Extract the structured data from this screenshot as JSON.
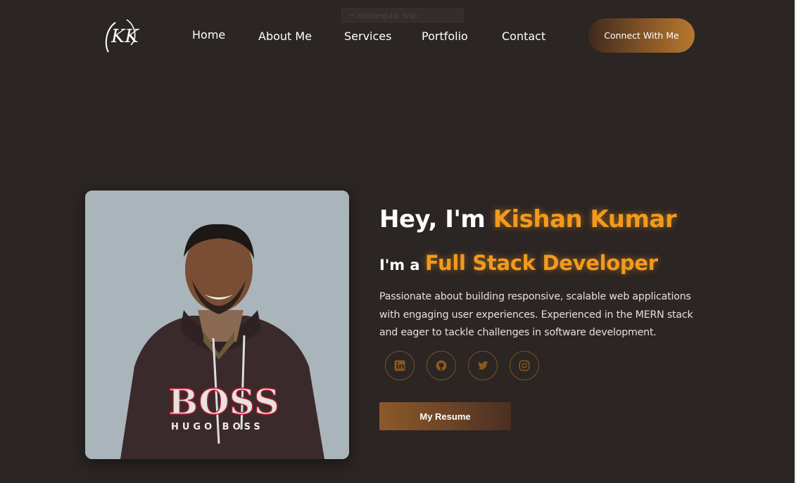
{
  "overlay": {
    "snip_label": "Rectangular Snip"
  },
  "brand": {
    "logo_text": "KK"
  },
  "nav": {
    "items": [
      {
        "label": "Home"
      },
      {
        "label": "About Me"
      },
      {
        "label": "Services"
      },
      {
        "label": "Portfolio"
      },
      {
        "label": "Contact"
      }
    ],
    "cta_label": "Connect With Me"
  },
  "hero": {
    "greeting": "Hey, I'm ",
    "name": "Kishan Kumar",
    "role_prefix": "I'm a ",
    "role": "Full Stack Developer",
    "bio": "Passionate about building responsive, scalable web applications with engaging user experiences. Experienced in the MERN stack and eager to tackle challenges in software development.",
    "photo": {
      "hoodie_brand": "BOSS",
      "hoodie_subtext": "HUGO BOSS"
    },
    "socials": [
      {
        "icon": "linkedin-icon"
      },
      {
        "icon": "github-icon"
      },
      {
        "icon": "twitter-icon"
      },
      {
        "icon": "instagram-icon"
      }
    ],
    "resume_label": "My Resume"
  },
  "colors": {
    "background": "#2b2524",
    "accent": "#f39a1c",
    "icon": "#8a5a1c",
    "button_gradient_start": "#3f2a1d",
    "button_gradient_end": "#b8782d",
    "photo_bg": "#a9b5ba"
  }
}
